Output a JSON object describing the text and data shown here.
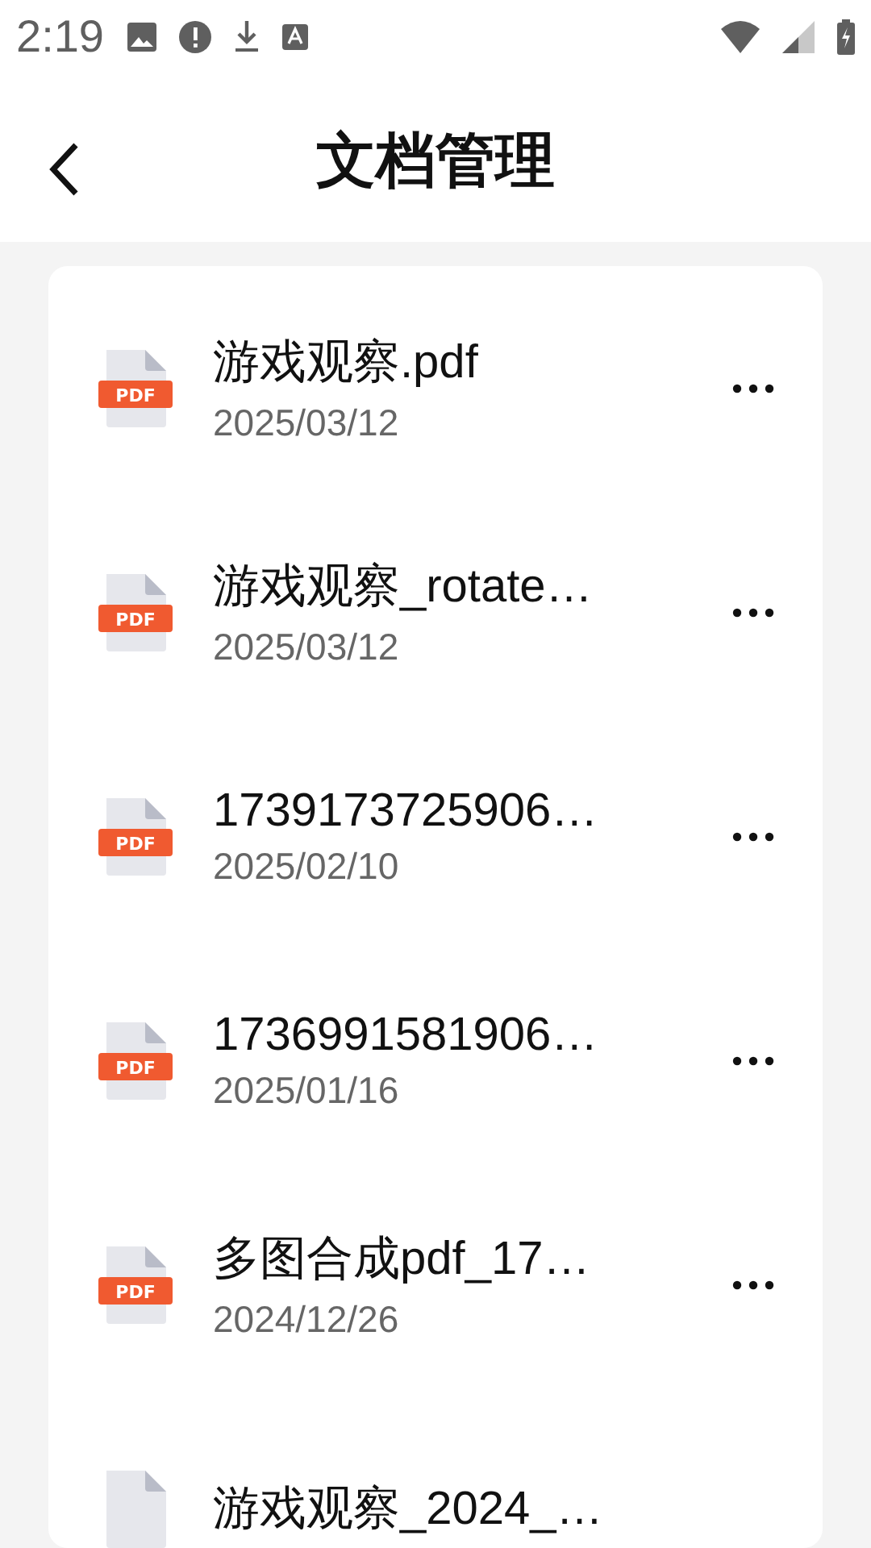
{
  "status_bar": {
    "time": "2:19"
  },
  "header": {
    "title": "文档管理"
  },
  "files": [
    {
      "badge": "PDF",
      "name": "游戏观察.pdf",
      "date": "2025/03/12"
    },
    {
      "badge": "PDF",
      "name": "游戏观察_rotate…",
      "date": "2025/03/12"
    },
    {
      "badge": "PDF",
      "name": "1739173725906…",
      "date": "2025/02/10"
    },
    {
      "badge": "PDF",
      "name": "1736991581906…",
      "date": "2025/01/16"
    },
    {
      "badge": "PDF",
      "name": "多图合成pdf_17…",
      "date": "2024/12/26"
    },
    {
      "name": "游戏观察_2024_…"
    }
  ]
}
